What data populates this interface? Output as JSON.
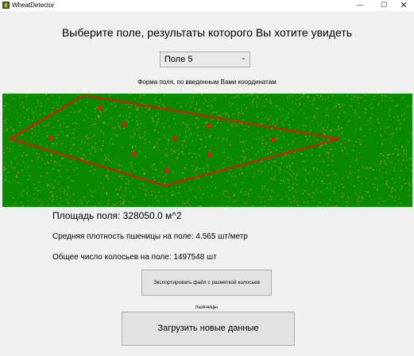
{
  "window": {
    "title": "WheatDetector",
    "icon": "wheat-app-icon",
    "controls": {
      "minimize": "—",
      "maximize": "☐",
      "close": "✕"
    }
  },
  "heading": "Выберите поле, результаты которого Вы хотите увидеть",
  "field_select": {
    "value": "Поле 5",
    "icon": "chevron-down-icon"
  },
  "shape_caption": "Форма поля, по введенным Вами координатам",
  "field_image": {
    "background_color": "#0a8a00",
    "speckle_color": "#c8924a",
    "outline_color": "#b82a12",
    "vertex_color": "#d42218"
  },
  "stats": {
    "area": "Площадь поля: 328050.0 м^2",
    "density": "Средняя плотность пшеницы на поле: 4.565 шт/метр",
    "count": "Общее число колосьев на поле: 1497548 шт"
  },
  "buttons": {
    "export": "Экспортировать файл с разметкой колосьев пшеницы",
    "load": "Загрузить новые данные"
  }
}
